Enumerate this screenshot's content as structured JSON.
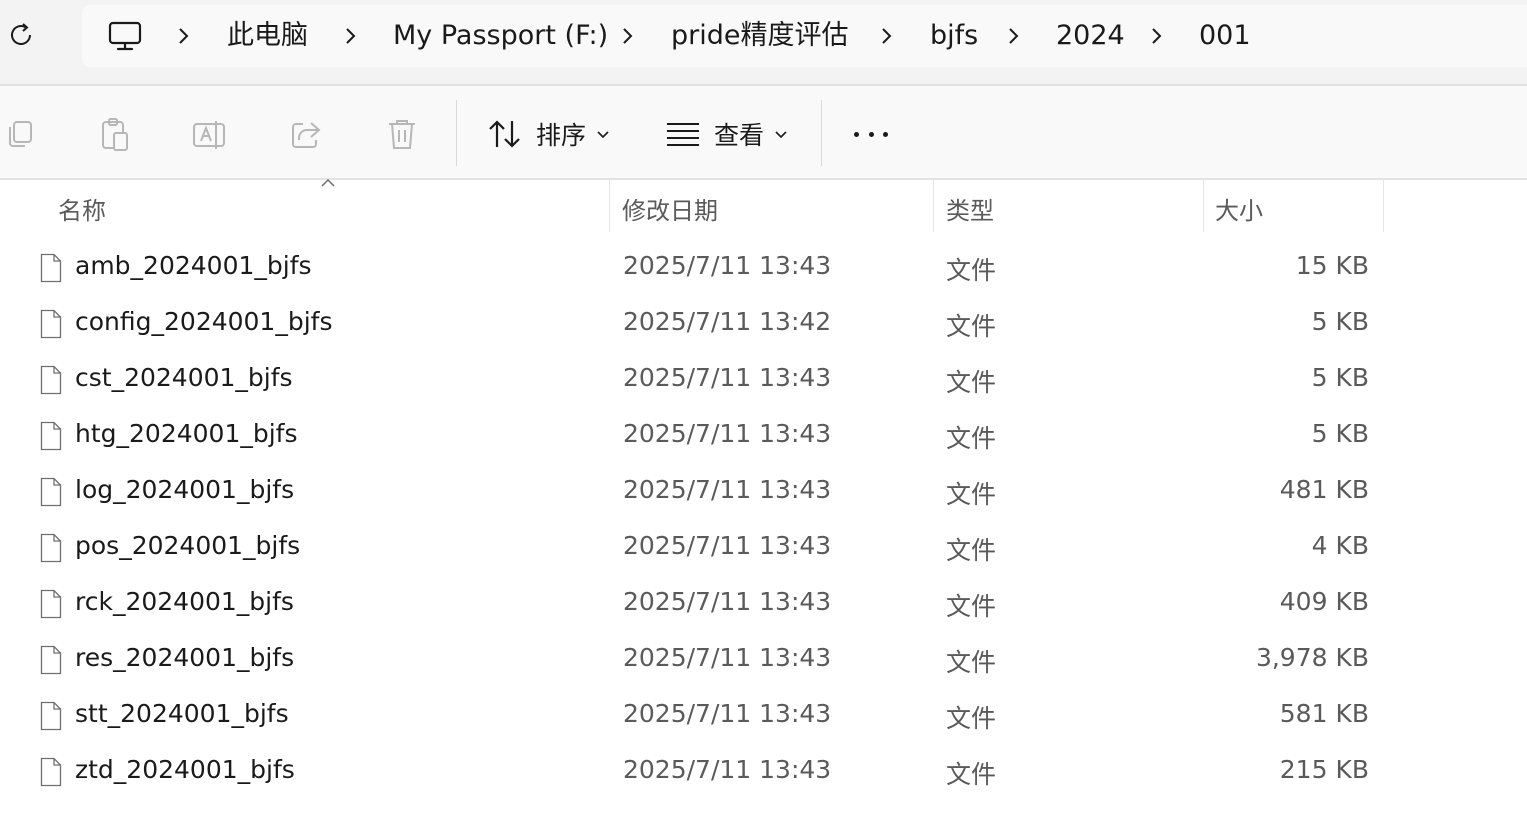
{
  "address_bar": {
    "this_pc_icon": "monitor-icon",
    "breadcrumbs": [
      "此电脑",
      "My Passport (F:)",
      "pride精度评估",
      "bjfs",
      "2024",
      "001"
    ]
  },
  "toolbar": {
    "icons": [
      "copy-icon",
      "paste-icon",
      "rename-icon",
      "share-icon",
      "delete-icon"
    ],
    "sort_label": "排序",
    "view_label": "查看",
    "more_icon": "more-icon"
  },
  "columns": {
    "name": "名称",
    "date": "修改日期",
    "type": "类型",
    "size": "大小"
  },
  "files": [
    {
      "name": "amb_2024001_bjfs",
      "date": "2025/7/11 13:43",
      "type": "文件",
      "size": "15 KB"
    },
    {
      "name": "config_2024001_bjfs",
      "date": "2025/7/11 13:42",
      "type": "文件",
      "size": "5 KB"
    },
    {
      "name": "cst_2024001_bjfs",
      "date": "2025/7/11 13:43",
      "type": "文件",
      "size": "5 KB"
    },
    {
      "name": "htg_2024001_bjfs",
      "date": "2025/7/11 13:43",
      "type": "文件",
      "size": "5 KB"
    },
    {
      "name": "log_2024001_bjfs",
      "date": "2025/7/11 13:43",
      "type": "文件",
      "size": "481 KB"
    },
    {
      "name": "pos_2024001_bjfs",
      "date": "2025/7/11 13:43",
      "type": "文件",
      "size": "4 KB"
    },
    {
      "name": "rck_2024001_bjfs",
      "date": "2025/7/11 13:43",
      "type": "文件",
      "size": "409 KB"
    },
    {
      "name": "res_2024001_bjfs",
      "date": "2025/7/11 13:43",
      "type": "文件",
      "size": "3,978 KB"
    },
    {
      "name": "stt_2024001_bjfs",
      "date": "2025/7/11 13:43",
      "type": "文件",
      "size": "581 KB"
    },
    {
      "name": "ztd_2024001_bjfs",
      "date": "2025/7/11 13:43",
      "type": "文件",
      "size": "215 KB"
    }
  ]
}
